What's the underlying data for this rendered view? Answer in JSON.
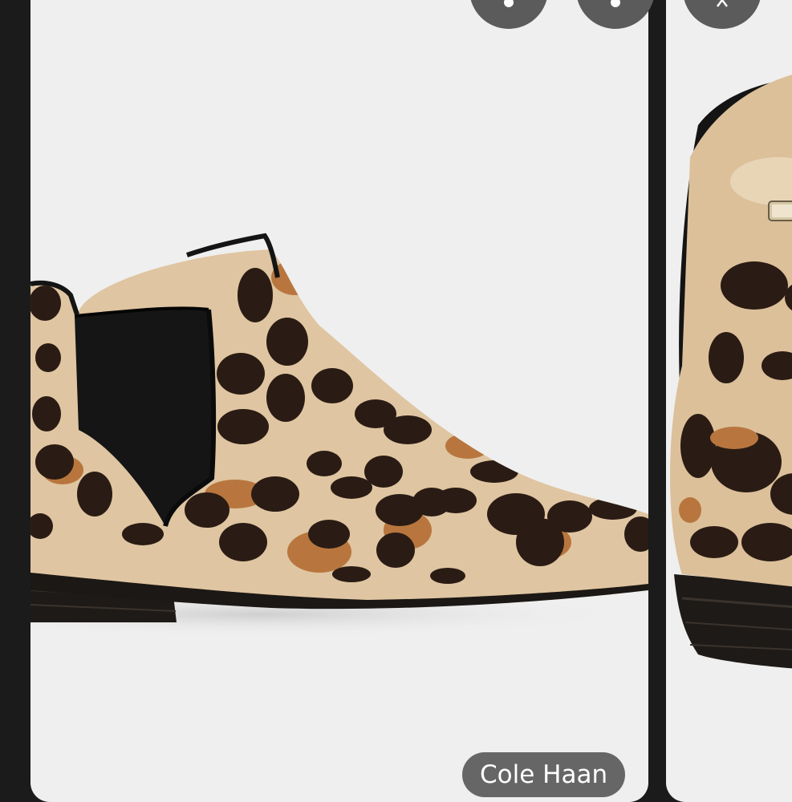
{
  "product_card": {
    "brand": "Cole Haan",
    "image": "leopard-print-chelsea-ankle-boot"
  },
  "next_card": {
    "image": "leopard-print-chelsea-ankle-boot-back-view"
  },
  "overlay_buttons": [
    {
      "icon": "info-icon"
    },
    {
      "icon": "more-options-icon"
    },
    {
      "icon": "expand-icon"
    }
  ],
  "colors": {
    "card_background": "#efefef",
    "page_background": "#1b1b1b",
    "chip_background": "#5a5a5a",
    "chip_text": "#ffffff",
    "leopard_base": "#dcc09a",
    "leopard_spots": "#2a1c14",
    "leopard_tan": "#b8763e",
    "elastic_panel": "#151515"
  }
}
